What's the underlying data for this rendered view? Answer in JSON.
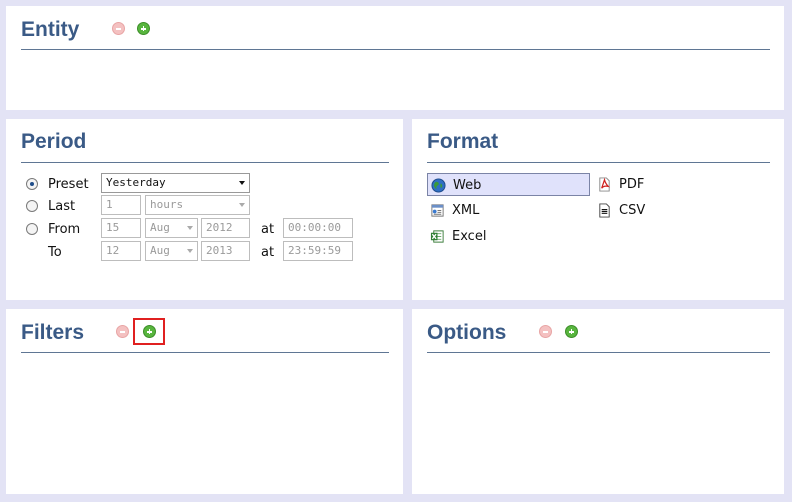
{
  "entity": {
    "title": "Entity"
  },
  "period": {
    "title": "Period",
    "preset": {
      "label": "Preset",
      "value": "Yesterday"
    },
    "last": {
      "label": "Last",
      "count": "1",
      "unit": "hours"
    },
    "from": {
      "label": "From",
      "day": "15",
      "month": "Aug",
      "year": "2012",
      "at_label": "at",
      "time": "00:00:00"
    },
    "to": {
      "label": "To",
      "day": "12",
      "month": "Aug",
      "year": "2013",
      "at_label": "at",
      "time": "23:59:59"
    }
  },
  "format": {
    "title": "Format",
    "options": {
      "web": "Web",
      "pdf": "PDF",
      "xml": "XML",
      "csv": "CSV",
      "excel": "Excel"
    },
    "selected": "Web"
  },
  "filters": {
    "title": "Filters"
  },
  "options": {
    "title": "Options"
  }
}
